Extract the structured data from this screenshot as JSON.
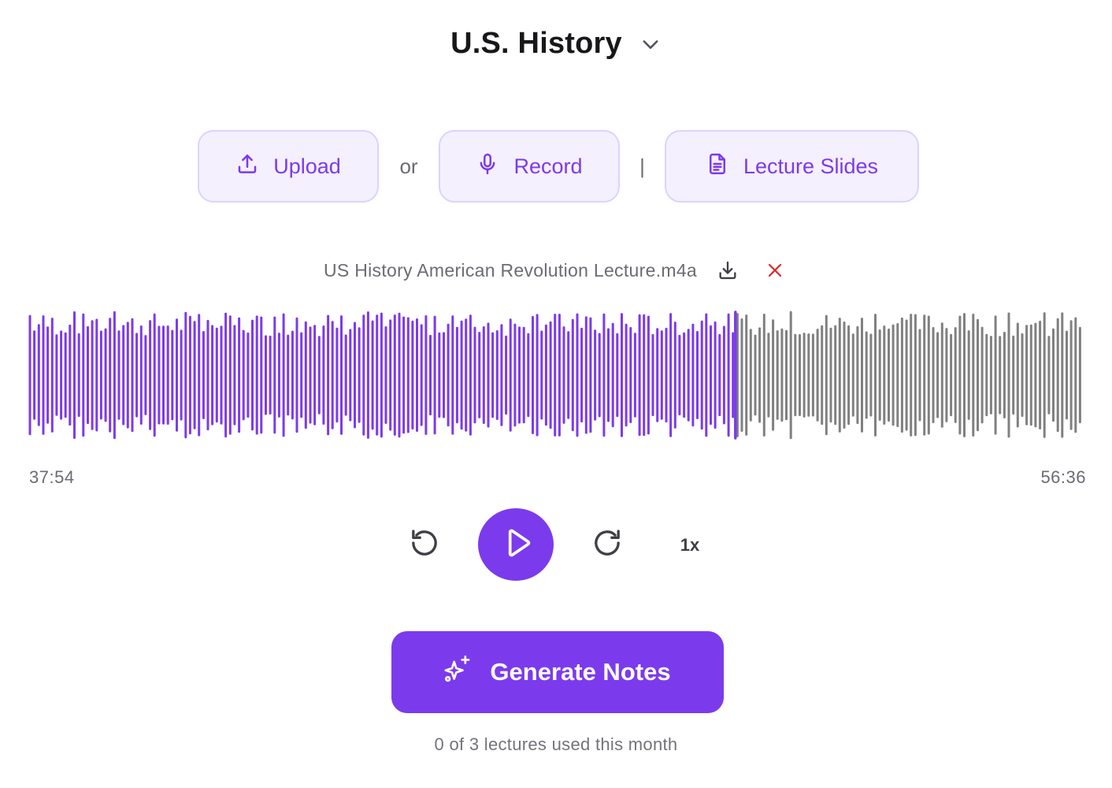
{
  "header": {
    "subject": "U.S. History",
    "chevron_icon": "chevron-down-icon"
  },
  "sources": {
    "upload_label": "Upload",
    "upload_icon": "upload-icon",
    "or_text": "or",
    "record_label": "Record",
    "record_icon": "microphone-icon",
    "divider_text": "|",
    "slides_label": "Lecture Slides",
    "slides_icon": "document-icon"
  },
  "file": {
    "name": "US History American Revolution Lecture.m4a",
    "download_icon": "download-icon",
    "remove_icon": "close-icon"
  },
  "player": {
    "current_time": "37:54",
    "total_time": "56:36",
    "progress": 0.67,
    "speed": "1x",
    "rewind_icon": "rewind-icon",
    "play_icon": "play-icon",
    "forward_icon": "forward-icon"
  },
  "actions": {
    "generate_label": "Generate Notes",
    "generate_icon": "sparkles-icon"
  },
  "usage_text": "0 of 3 lectures used this month",
  "colors": {
    "accent": "#7c3aed",
    "accent_soft": "#f4f0fe",
    "accent_border": "#ddd3fb",
    "waveform_played": "#7c3aed",
    "waveform_unplayed": "#808080",
    "remove": "#dc2626"
  }
}
